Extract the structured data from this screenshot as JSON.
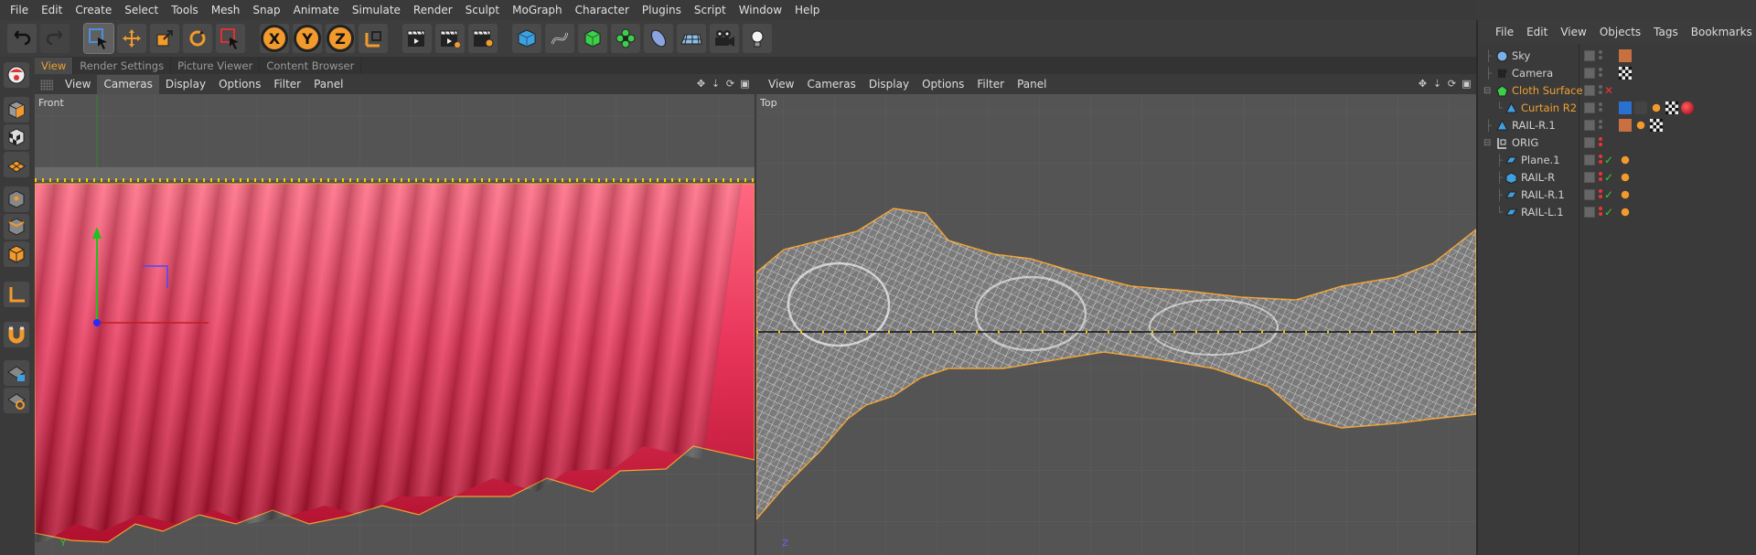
{
  "menubar": {
    "items": [
      "File",
      "Edit",
      "Create",
      "Select",
      "Tools",
      "Mesh",
      "Snap",
      "Animate",
      "Simulate",
      "Render",
      "Sculpt",
      "MoGraph",
      "Character",
      "Plugins",
      "Script",
      "Window",
      "Help"
    ]
  },
  "toolbar": {
    "axis_labels": [
      "X",
      "Y",
      "Z"
    ]
  },
  "tabs": [
    {
      "label": "View",
      "active": true
    },
    {
      "label": "Render Settings",
      "active": false
    },
    {
      "label": "Picture Viewer",
      "active": false
    },
    {
      "label": "Content Browser",
      "active": false
    }
  ],
  "viewport_left": {
    "menu": [
      "View",
      "Cameras",
      "Display",
      "Options",
      "Filter",
      "Panel"
    ],
    "active_menu": "Cameras",
    "label": "Front",
    "axis_y": "Y"
  },
  "viewport_right": {
    "menu": [
      "View",
      "Cameras",
      "Display",
      "Options",
      "Filter",
      "Panel"
    ],
    "label": "Top",
    "axis_z": "Z"
  },
  "object_manager": {
    "menu": [
      "File",
      "Edit",
      "View",
      "Objects",
      "Tags",
      "Bookmarks"
    ],
    "objects": [
      {
        "name": "Sky",
        "color": "#d0d0d0",
        "state": "none"
      },
      {
        "name": "Camera",
        "color": "#d0d0d0",
        "state": "none"
      },
      {
        "name": "Cloth Surface",
        "color": "#f0a030",
        "state": "x"
      },
      {
        "name": "Curtain R2",
        "color": "#f0a030",
        "state": "none"
      },
      {
        "name": "RAIL-R.1",
        "color": "#d0d0d0",
        "state": "none"
      },
      {
        "name": "ORIG",
        "color": "#d0d0d0",
        "state": "none"
      },
      {
        "name": "Plane.1",
        "color": "#d0d0d0",
        "state": "check"
      },
      {
        "name": "RAIL-R",
        "color": "#d0d0d0",
        "state": "check"
      },
      {
        "name": "RAIL-R.1",
        "color": "#d0d0d0",
        "state": "check"
      },
      {
        "name": "RAIL-L.1",
        "color": "#d0d0d0",
        "state": "check"
      }
    ]
  },
  "colors": {
    "accent": "#f0a030",
    "curtain": "#e03050",
    "background": "#3b3b3b",
    "viewport": "#545454"
  }
}
